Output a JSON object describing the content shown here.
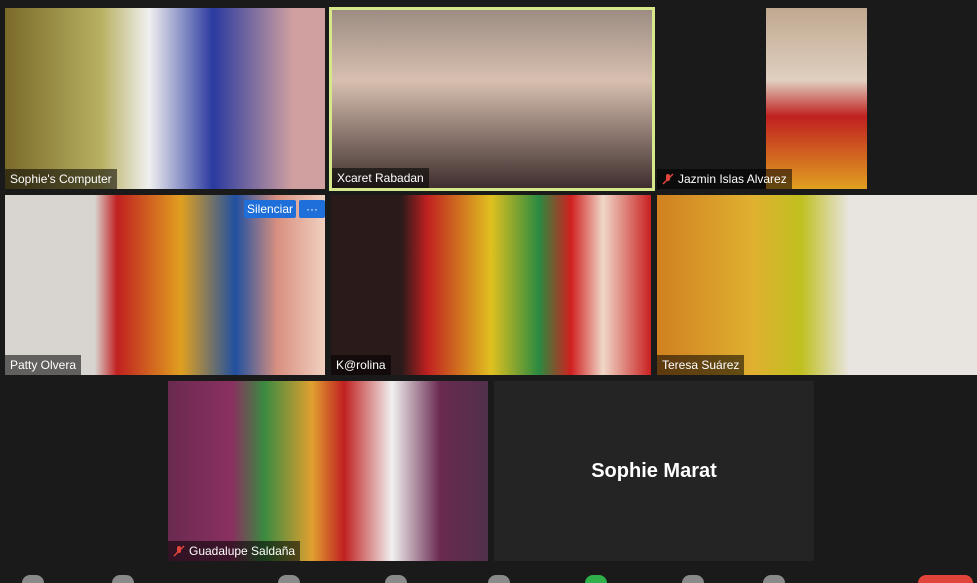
{
  "participants": [
    {
      "name": "Sophie's Computer",
      "muted": false,
      "active": false
    },
    {
      "name": "Xcaret Rabadan",
      "muted": false,
      "active": true
    },
    {
      "name": "Jazmin Islas Alvarez",
      "muted": true,
      "active": false
    },
    {
      "name": "Patty Olvera",
      "muted": false,
      "active": false
    },
    {
      "name": "K@rolina",
      "muted": false,
      "active": false
    },
    {
      "name": "Teresa Suárez",
      "muted": false,
      "active": false
    },
    {
      "name": "Guadalupe Saldaña",
      "muted": true,
      "active": false
    },
    {
      "name": "Sophie Marat",
      "muted": false,
      "active": false,
      "video_off": true
    }
  ],
  "controls": {
    "mute_label": "Silenciar",
    "more_label": "···"
  },
  "colors": {
    "active_border": "#d6e88a",
    "mute_button": "#1e6fd9",
    "muted_mic": "#e0443a"
  }
}
